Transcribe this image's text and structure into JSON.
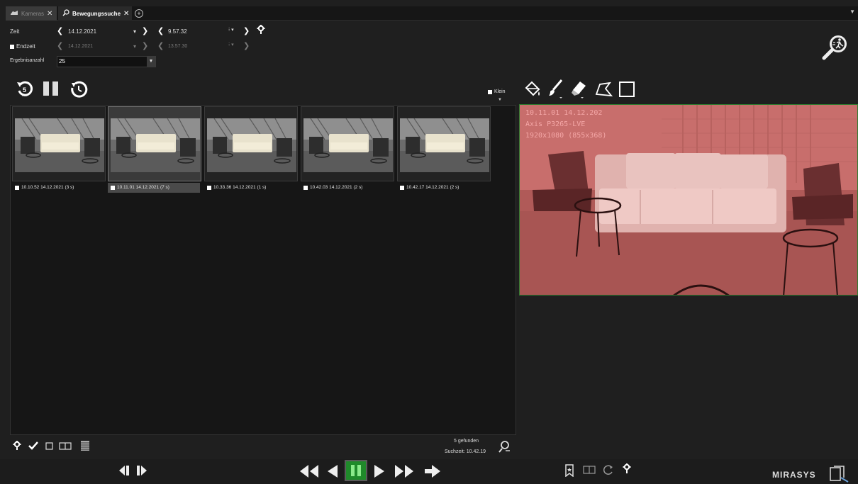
{
  "tabs": [
    {
      "label": "Kameras",
      "active": false
    },
    {
      "label": "Bewegungssuche",
      "active": true
    }
  ],
  "time_row": {
    "label": "Zeit",
    "date": "14.12.2021",
    "time": "9.57.32"
  },
  "end_row": {
    "label": "Endzeit",
    "date": "14.12.2021",
    "time": "13.57.30"
  },
  "results_count": {
    "label": "Ergebnisanzahl",
    "value": "25"
  },
  "size_toggle": {
    "label": "Klein"
  },
  "thumbnails": [
    {
      "caption": "10.10.52 14.12.2021 (3 s)",
      "selected": false
    },
    {
      "caption": "10.11.01 14.12.2021 (7 s)",
      "selected": true
    },
    {
      "caption": "10.33.36 14.12.2021 (1 s)",
      "selected": false
    },
    {
      "caption": "10.42.03 14.12.2021 (2 s)",
      "selected": false
    },
    {
      "caption": "10.42.17 14.12.2021 (2 s)",
      "selected": false
    }
  ],
  "camera_overlay": {
    "line1": "10.11.01 14.12.202",
    "line2": "Axis P3265-LVE",
    "line3": "1920x1080 (855x368)"
  },
  "status": {
    "found": "5 gefunden",
    "search_time": "Suchzeit: 10.42.19"
  },
  "brand": "MIRASYS",
  "colors": {
    "accent_green": "#1f8a2a",
    "mask_red": "#c85a5a",
    "background": "#1f1f1f"
  },
  "icons": [
    "camera-icon",
    "search-motion-icon",
    "gear-icon",
    "rewind-5min-icon",
    "pause-icon",
    "clock-icon",
    "paint-bucket-icon",
    "brush-icon",
    "eraser-icon",
    "polygon-icon",
    "rectangle-icon",
    "checkmark-icon",
    "split-view-icon",
    "filmstrip-icon",
    "search-person-icon",
    "prev-frame-icon",
    "next-frame-icon",
    "fast-rewind-icon",
    "play-reverse-icon",
    "play-icon",
    "fast-forward-icon",
    "jump-icon",
    "bookmark-icon",
    "layout-icon",
    "refresh-icon"
  ]
}
